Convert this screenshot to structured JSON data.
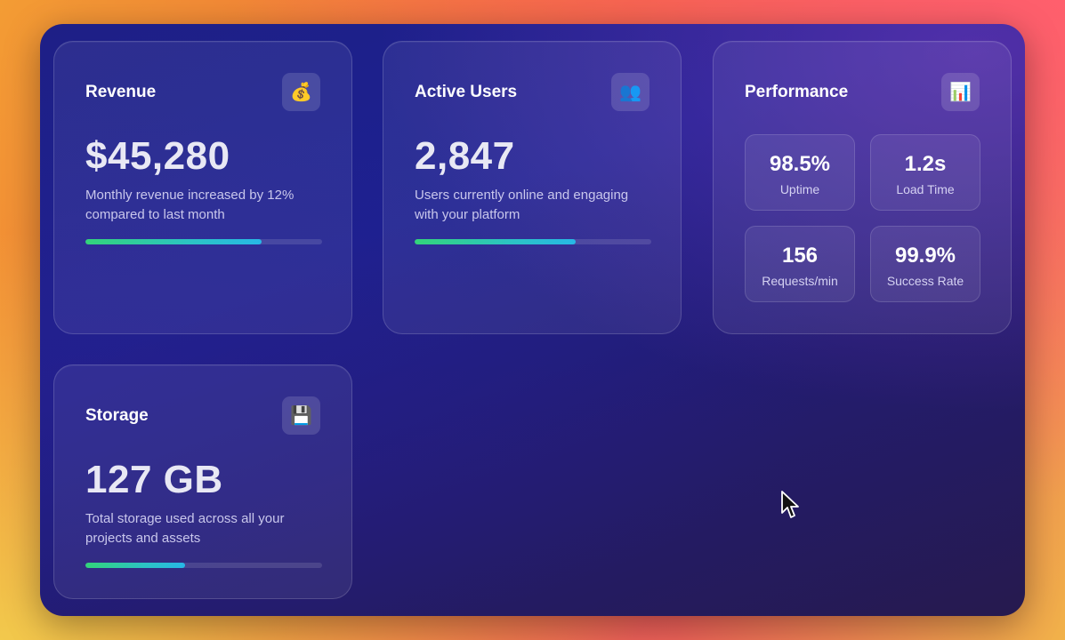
{
  "cards": {
    "revenue": {
      "title": "Revenue",
      "icon": "money-bag-icon",
      "value": "$45,280",
      "description": "Monthly revenue increased by 12% compared to last month",
      "progress": 0.745
    },
    "active_users": {
      "title": "Active Users",
      "icon": "users-icon",
      "value": "2,847",
      "description": "Users currently online and engaging with your platform",
      "progress": 0.68
    },
    "performance": {
      "title": "Performance",
      "icon": "bar-chart-icon",
      "stats": [
        {
          "value": "98.5%",
          "label": "Uptime"
        },
        {
          "value": "1.2s",
          "label": "Load Time"
        },
        {
          "value": "156",
          "label": "Requests/min"
        },
        {
          "value": "99.9%",
          "label": "Success Rate"
        }
      ]
    },
    "storage": {
      "title": "Storage",
      "icon": "floppy-disk-icon",
      "value": "127 GB",
      "description": "Total storage used across all your projects and assets",
      "progress": 0.42
    }
  },
  "colors": {
    "progress_start": "#33d47a",
    "progress_end": "#27b8e6",
    "frame_bg": "#1e1f86"
  }
}
